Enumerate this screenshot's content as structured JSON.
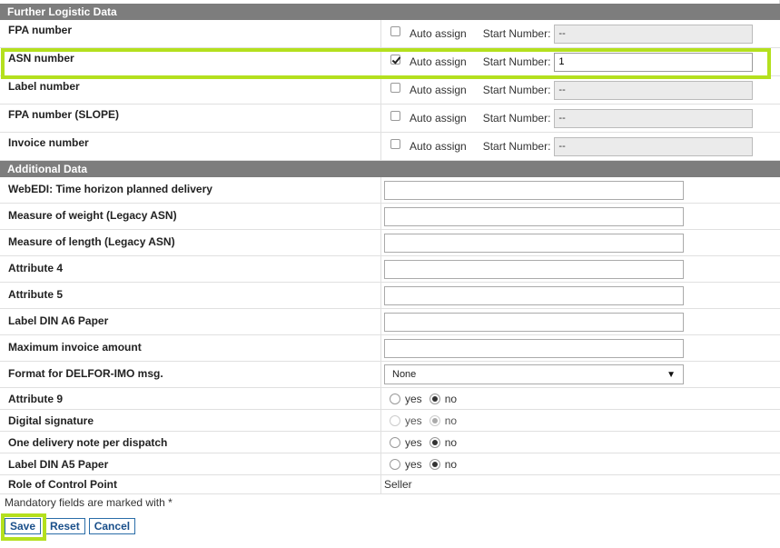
{
  "logistic": {
    "header": "Further Logistic Data",
    "auto_assign_label": "Auto assign",
    "start_number_label": "Start Number:",
    "rows": [
      {
        "label": "FPA number",
        "checked": false,
        "start": "--"
      },
      {
        "label": "ASN number",
        "checked": true,
        "start": "1"
      },
      {
        "label": "Label number",
        "checked": false,
        "start": "--"
      },
      {
        "label": "FPA number (SLOPE)",
        "checked": false,
        "start": "--"
      },
      {
        "label": "Invoice number",
        "checked": false,
        "start": "--"
      }
    ]
  },
  "additional": {
    "header": "Additional Data",
    "text_rows": [
      {
        "label": "WebEDI: Time horizon planned delivery",
        "value": ""
      },
      {
        "label": "Measure of weight (Legacy ASN)",
        "value": ""
      },
      {
        "label": "Measure of length (Legacy ASN)",
        "value": ""
      },
      {
        "label": "Attribute 4",
        "value": ""
      },
      {
        "label": "Attribute 5",
        "value": ""
      },
      {
        "label": "Label DIN A6 Paper",
        "value": ""
      },
      {
        "label": "Maximum invoice amount",
        "value": ""
      }
    ],
    "select_row": {
      "label": "Format for DELFOR-IMO msg.",
      "value": "None"
    },
    "yes_label": "yes",
    "no_label": "no",
    "radio_rows": [
      {
        "label": "Attribute 9",
        "selected": "no",
        "disabled": false
      },
      {
        "label": "Digital signature",
        "selected": "no",
        "disabled": true
      },
      {
        "label": "One delivery note per dispatch",
        "selected": "no",
        "disabled": false
      },
      {
        "label": "Label DIN A5 Paper",
        "selected": "no",
        "disabled": false
      }
    ],
    "static_row": {
      "label": "Role of Control Point",
      "value": "Seller"
    }
  },
  "footnote": "Mandatory fields are marked with *",
  "buttons": {
    "save": "Save",
    "reset": "Reset",
    "cancel": "Cancel"
  },
  "colors": {
    "highlight": "#b4e01e",
    "header_bg": "#7d7d7d",
    "button_border": "#2a6da8"
  }
}
